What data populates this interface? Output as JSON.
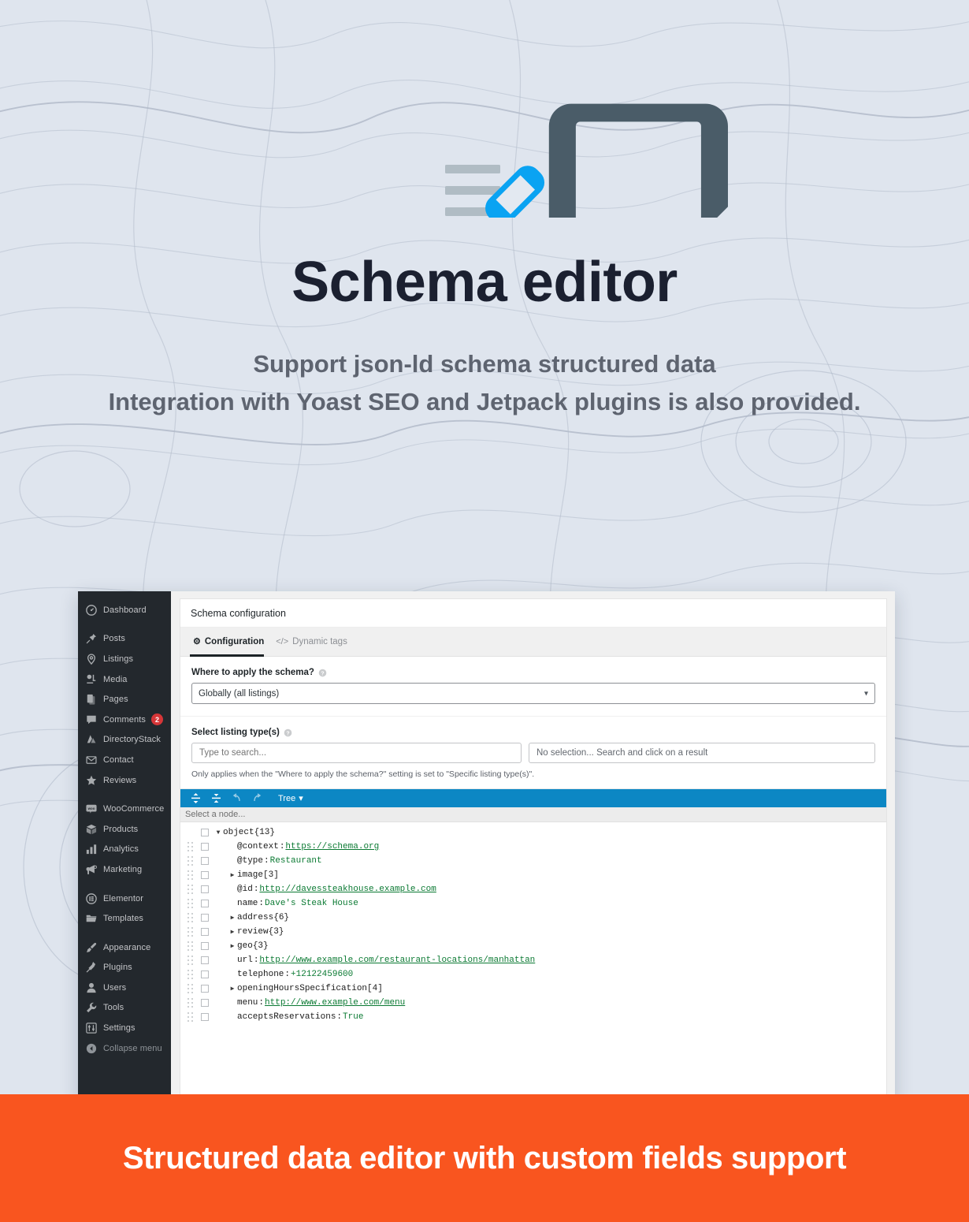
{
  "hero": {
    "icon": "document-pencil-icon",
    "title": "Schema editor",
    "subtitle_line1": "Support json-ld schema structured data",
    "subtitle_line2": "Integration with Yoast SEO and Jetpack plugins is also provided."
  },
  "colors": {
    "background": "#dfe5ee",
    "accent_blue": "#0c87c4",
    "icon_blue": "#0aa3f2",
    "icon_dark": "#4a5c68",
    "footer_orange": "#f9551f",
    "sidebar_dark": "#23282d",
    "json_value_green": "#0b7a33",
    "badge_red": "#d63638"
  },
  "sidebar": {
    "items": [
      {
        "label": "Dashboard",
        "icon": "dashboard-icon",
        "gap_after": true
      },
      {
        "label": "Posts",
        "icon": "pin-icon"
      },
      {
        "label": "Listings",
        "icon": "map-pin-icon"
      },
      {
        "label": "Media",
        "icon": "media-icon"
      },
      {
        "label": "Pages",
        "icon": "pages-icon"
      },
      {
        "label": "Comments",
        "icon": "comment-icon",
        "badge": "2"
      },
      {
        "label": "DirectoryStack",
        "icon": "directorystack-icon"
      },
      {
        "label": "Contact",
        "icon": "envelope-icon"
      },
      {
        "label": "Reviews",
        "icon": "star-icon",
        "gap_after": true
      },
      {
        "label": "WooCommerce",
        "icon": "woocommerce-icon"
      },
      {
        "label": "Products",
        "icon": "box-icon"
      },
      {
        "label": "Analytics",
        "icon": "bar-chart-icon"
      },
      {
        "label": "Marketing",
        "icon": "megaphone-icon",
        "gap_after": true
      },
      {
        "label": "Elementor",
        "icon": "elementor-icon"
      },
      {
        "label": "Templates",
        "icon": "folder-icon",
        "gap_after": true
      },
      {
        "label": "Appearance",
        "icon": "paintbrush-icon"
      },
      {
        "label": "Plugins",
        "icon": "plug-icon"
      },
      {
        "label": "Users",
        "icon": "user-icon"
      },
      {
        "label": "Tools",
        "icon": "wrench-icon"
      },
      {
        "label": "Settings",
        "icon": "sliders-icon"
      },
      {
        "label": "Collapse menu",
        "icon": "collapse-arrow-icon",
        "muted": true
      }
    ]
  },
  "panel": {
    "heading": "Schema configuration",
    "tabs": [
      {
        "label": "Configuration",
        "icon": "gear-icon",
        "active": true
      },
      {
        "label": "Dynamic tags",
        "icon": "code-icon",
        "active": false
      }
    ],
    "where_to_apply": {
      "label": "Where to apply the schema?",
      "help_icon": "help-icon",
      "selected": "Globally (all listings)",
      "options": [
        "Globally (all listings)",
        "Specific listing type(s)"
      ]
    },
    "listing_types": {
      "label": "Select listing type(s)",
      "help_icon": "help-icon",
      "search_placeholder": "Type to search...",
      "search_value": "",
      "selection_text": "No selection... Search and click on a result",
      "note": "Only applies when the \"Where to apply the schema?\" setting is set to \"Specific listing type(s)\"."
    }
  },
  "json_editor": {
    "toolbar": {
      "expand_all": "expand-all-icon",
      "collapse_all": "collapse-all-icon",
      "undo": "undo-icon",
      "redo": "redo-icon",
      "mode_label": "Tree",
      "mode_caret": "caret-down-icon"
    },
    "status_text": "Select a node...",
    "rows": [
      {
        "indent": 0,
        "handle": false,
        "toggle": "open",
        "key": "object",
        "sep": "",
        "count": "{13}",
        "value": "",
        "link": false
      },
      {
        "indent": 1,
        "handle": true,
        "toggle": "none",
        "key": "@context",
        "sep": ":",
        "count": "",
        "value": "https://schema.org",
        "link": true
      },
      {
        "indent": 1,
        "handle": true,
        "toggle": "none",
        "key": "@type",
        "sep": ":",
        "count": "",
        "value": "Restaurant",
        "link": false
      },
      {
        "indent": 1,
        "handle": true,
        "toggle": "closed",
        "key": "image",
        "sep": "",
        "count": "[3]",
        "value": "",
        "link": false
      },
      {
        "indent": 1,
        "handle": true,
        "toggle": "none",
        "key": "@id ",
        "sep": ":",
        "count": "",
        "value": "http://davessteakhouse.example.com",
        "link": true
      },
      {
        "indent": 1,
        "handle": true,
        "toggle": "none",
        "key": "name",
        "sep": ":",
        "count": "",
        "value": "Dave's Steak House",
        "link": false
      },
      {
        "indent": 1,
        "handle": true,
        "toggle": "closed",
        "key": "address",
        "sep": "",
        "count": "{6}",
        "value": "",
        "link": false
      },
      {
        "indent": 1,
        "handle": true,
        "toggle": "closed",
        "key": "review",
        "sep": "",
        "count": "{3}",
        "value": "",
        "link": false
      },
      {
        "indent": 1,
        "handle": true,
        "toggle": "closed",
        "key": "geo ",
        "sep": "",
        "count": "{3}",
        "value": "",
        "link": false
      },
      {
        "indent": 1,
        "handle": true,
        "toggle": "none",
        "key": "url ",
        "sep": ":",
        "count": "",
        "value": "http://www.example.com/restaurant-locations/manhattan",
        "link": true
      },
      {
        "indent": 1,
        "handle": true,
        "toggle": "none",
        "key": "telephone",
        "sep": ":",
        "count": "",
        "value": "+12122459600",
        "link": false
      },
      {
        "indent": 1,
        "handle": true,
        "toggle": "closed",
        "key": "openingHoursSpecification",
        "sep": "",
        "count": "[4]",
        "value": "",
        "link": false
      },
      {
        "indent": 1,
        "handle": true,
        "toggle": "none",
        "key": "menu",
        "sep": ":",
        "count": "",
        "value": "http://www.example.com/menu",
        "link": true
      },
      {
        "indent": 1,
        "handle": true,
        "toggle": "none",
        "key": "acceptsReservations",
        "sep": ":",
        "count": "",
        "value": "True",
        "link": false
      }
    ]
  },
  "footer": {
    "caption": "Structured data editor with custom fields support"
  }
}
